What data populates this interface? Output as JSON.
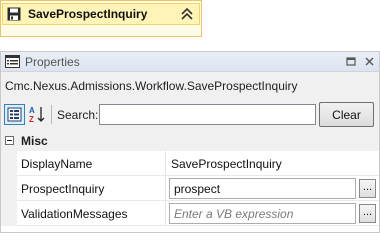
{
  "activity": {
    "title": "SaveProspectInquiry",
    "icon": "save-disk-icon",
    "collapse_icon": "double-chevron-up-icon"
  },
  "properties": {
    "title": "Properties",
    "pin_icon": "window-position-icon",
    "close_icon": "close-icon",
    "selected_type": "Cmc.Nexus.Admissions.Workflow.SaveProspectInquiry",
    "search_label": "Search:",
    "search_value": "",
    "clear_label": "Clear",
    "category": "Misc",
    "rows": [
      {
        "name": "DisplayName",
        "value": "SaveProspectInquiry",
        "editable": false,
        "placeholder": false
      },
      {
        "name": "ProspectInquiry",
        "value": "prospect",
        "editable": true,
        "placeholder": false
      },
      {
        "name": "ValidationMessages",
        "value": "Enter a VB expression",
        "editable": true,
        "placeholder": true
      }
    ],
    "ellipsis_label": "..."
  },
  "colors": {
    "activity_bg": "#fff4b8",
    "activity_border": "#e8c56a",
    "selected_tool": "#dbeefb"
  }
}
